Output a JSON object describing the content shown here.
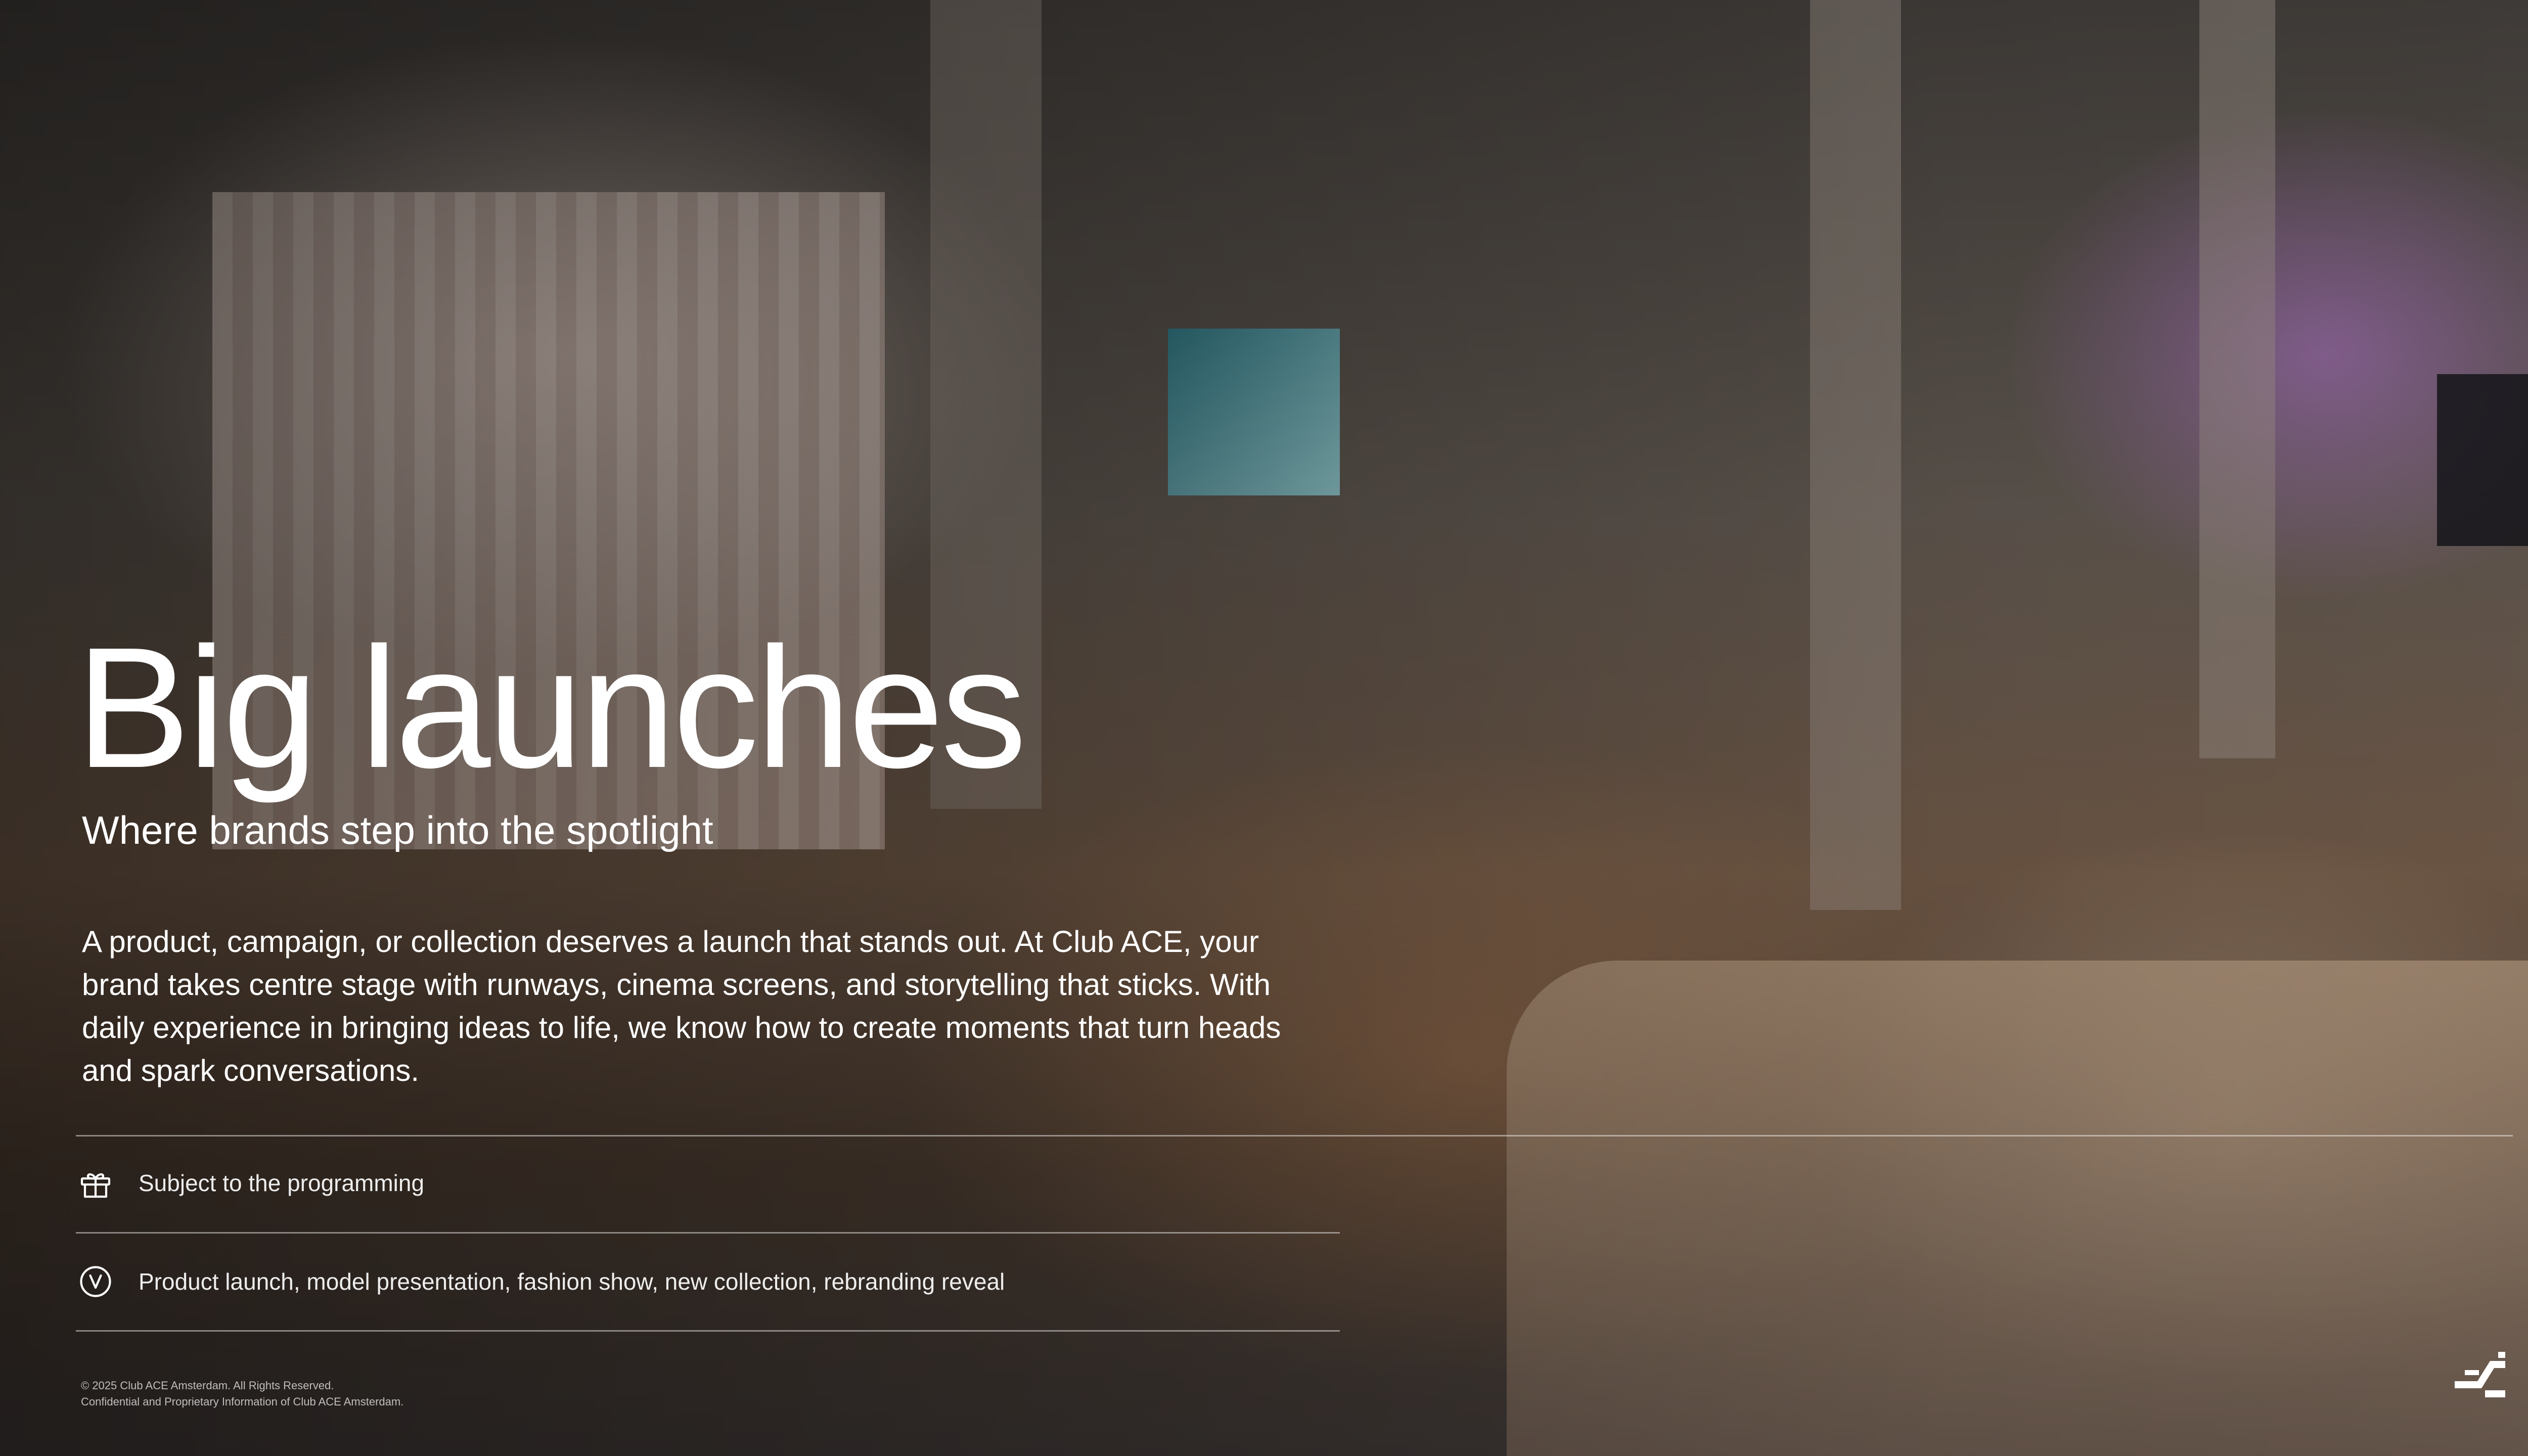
{
  "slide": {
    "title": "Big launches",
    "subtitle": "Where brands step into the spotlight",
    "description": "A product, campaign, or collection deserves a launch that stands out. At Club ACE, your brand takes centre stage with runways, cinema screens, and storytelling that sticks. With daily experience in bringing ideas to life, we know how to create moments that turn heads and spark conversations.",
    "features": [
      {
        "icon": "gift-icon",
        "text": "Subject to the programming"
      },
      {
        "icon": "checkmark-circle-icon",
        "text": "Product launch, model presentation, fashion show, new collection, rebranding reveal"
      }
    ]
  },
  "footer": {
    "copyright": "© 2025 Club ACE Amsterdam. All Rights Reserved.",
    "confidential": "Confidential and Proprietary Information of Club ACE Amsterdam."
  },
  "brand": {
    "logo_icon": "club-ace-logo-icon"
  },
  "colors": {
    "text": "#ffffff",
    "divider": "rgba(255,255,255,0.45)"
  }
}
